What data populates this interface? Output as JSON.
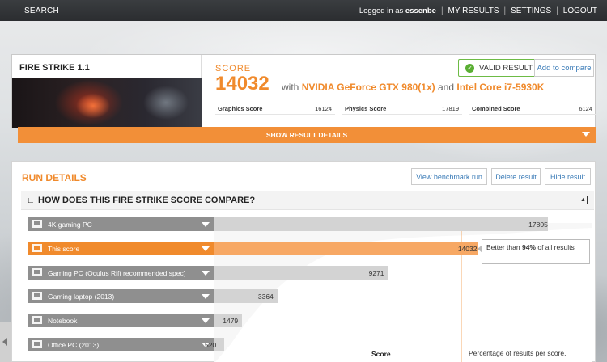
{
  "nav": {
    "search": "SEARCH",
    "logged_in_prefix": "Logged in as",
    "username": "essenbe",
    "sep": "|",
    "my_results": "MY RESULTS",
    "settings": "SETTINGS",
    "logout": "LOGOUT"
  },
  "result": {
    "benchmark": "FIRE STRIKE 1.1",
    "score_label": "SCORE",
    "score": "14032",
    "with": "with",
    "gpu": "NVIDIA GeForce GTX 980(1x)",
    "and": "and",
    "cpu": "Intel Core i7-5930K",
    "valid_label": "VALID RESULT",
    "valid_icon": "check-icon",
    "compare_label": "Add to compare",
    "subscores": [
      {
        "label": "Graphics Score",
        "value": "16124"
      },
      {
        "label": "Physics Score",
        "value": "17819"
      },
      {
        "label": "Combined Score",
        "value": "6124"
      }
    ],
    "show_details": "SHOW RESULT DETAILS"
  },
  "run": {
    "title": "RUN DETAILS",
    "view_run": "View benchmark run",
    "delete": "Delete result",
    "hide": "Hide result",
    "compare_title": "HOW DOES THIS FIRE STRIKE SCORE COMPARE?"
  },
  "chart_data": {
    "type": "bar",
    "categories": [
      "4K gaming PC",
      "This score",
      "Gaming PC (Oculus Rift recommended spec)",
      "Gaming laptop (2013)",
      "Notebook",
      "Office PC (2013)"
    ],
    "values": [
      17805,
      14032,
      9271,
      3364,
      1479,
      520
    ],
    "value_labels": [
      "17805",
      "14032",
      "9271",
      "3364",
      "1479",
      "520"
    ],
    "highlight": "This score",
    "xlabel": "Score",
    "xlabel2": "Percentage of results per score.",
    "tooltip": {
      "prefix": "Better than",
      "percent": "94%",
      "suffix": "of all results"
    },
    "colors": {
      "default": "#8f8f8f",
      "highlight": "#f08a2c"
    }
  }
}
